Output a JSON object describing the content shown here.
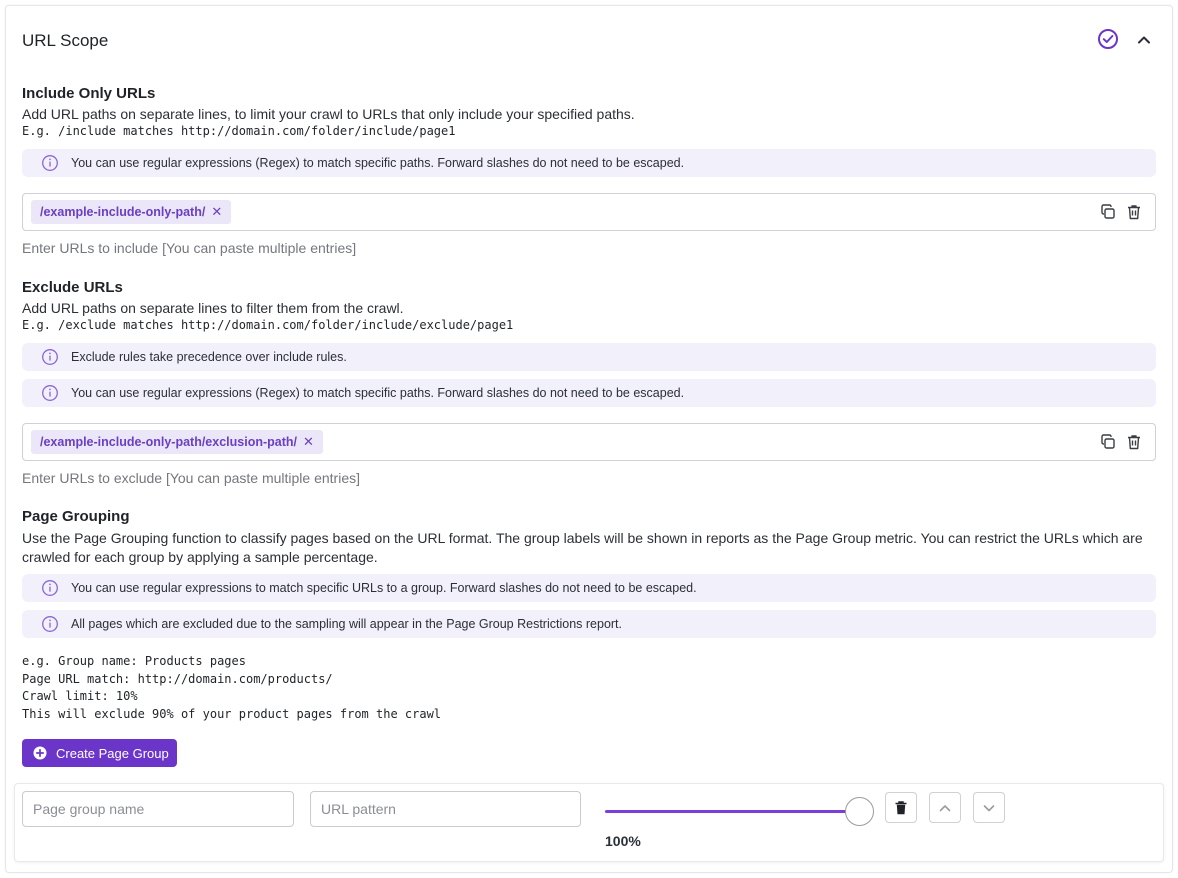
{
  "header": {
    "title": "URL Scope"
  },
  "include": {
    "title": "Include Only URLs",
    "description": "Add URL paths on separate lines, to limit your crawl to URLs that only include your specified paths.",
    "example": "E.g. /include matches http://domain.com/folder/include/page1",
    "info": [
      "You can use regular expressions (Regex) to match specific paths. Forward slashes do not need to be escaped."
    ],
    "chip": "/example-include-only-path/",
    "hint": "Enter URLs to include [You can paste multiple entries]"
  },
  "exclude": {
    "title": "Exclude URLs",
    "description": "Add URL paths on separate lines to filter them from the crawl.",
    "example": "E.g. /exclude matches http://domain.com/folder/include/exclude/page1",
    "info": [
      "Exclude rules take precedence over include rules.",
      "You can use regular expressions (Regex) to match specific paths. Forward slashes do not need to be escaped."
    ],
    "chip": "/example-include-only-path/exclusion-path/",
    "hint": "Enter URLs to exclude [You can paste multiple entries]"
  },
  "grouping": {
    "title": "Page Grouping",
    "description_line1": "Use the Page Grouping function to classify pages based on the URL format. The group labels will be shown in reports as the Page Group metric. You can restrict the URLs which are",
    "description_line2": "crawled for each group by applying a sample percentage.",
    "info": [
      "You can use regular expressions to match specific URLs to a group. Forward slashes do not need to be escaped.",
      "All pages which are excluded due to the sampling will appear in the Page Group Restrictions report."
    ],
    "example_lines": [
      "e.g. Group name: Products pages",
      "Page URL match: http://domain.com/products/",
      "Crawl limit: 10%",
      "This will exclude 90% of your product pages from the crawl"
    ],
    "create_button": "Create Page Group",
    "row": {
      "name_placeholder": "Page group name",
      "pattern_placeholder": "URL pattern",
      "slider_value": "100%",
      "slider_fraction": 1.0
    }
  },
  "colors": {
    "accent": "#6c35c9",
    "info_bg": "#f2f0fb",
    "chip_bg": "#ece7f8",
    "chip_text": "#6a3fc4"
  }
}
